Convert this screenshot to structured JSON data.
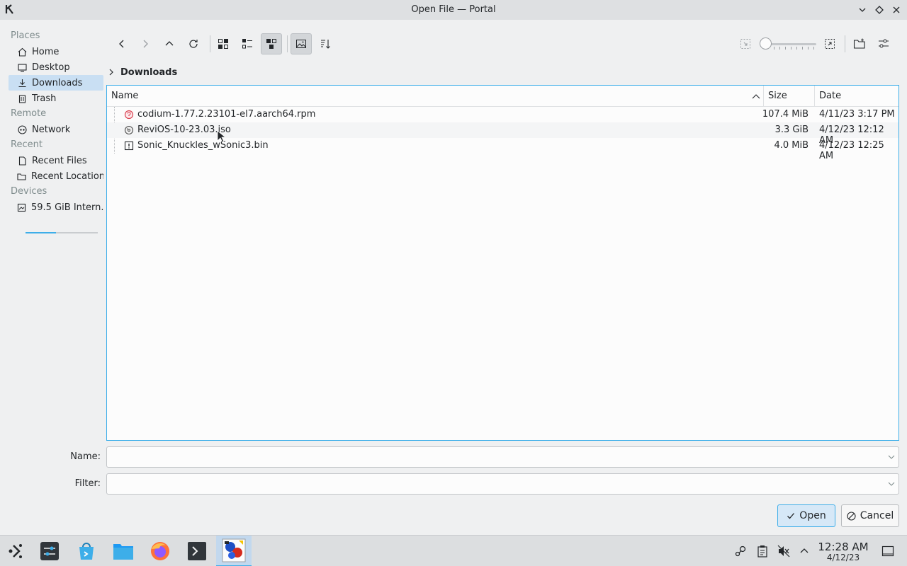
{
  "window": {
    "title": "Open File — Portal"
  },
  "sidebar": {
    "sections": [
      {
        "label": "Places",
        "items": [
          {
            "label": "Home",
            "icon": "home-icon"
          },
          {
            "label": "Desktop",
            "icon": "desktop-icon"
          },
          {
            "label": "Downloads",
            "icon": "download-icon",
            "active": true
          },
          {
            "label": "Trash",
            "icon": "trash-icon"
          }
        ]
      },
      {
        "label": "Remote",
        "items": [
          {
            "label": "Network",
            "icon": "network-icon"
          }
        ]
      },
      {
        "label": "Recent",
        "items": [
          {
            "label": "Recent Files",
            "icon": "recent-files-icon"
          },
          {
            "label": "Recent Locations",
            "icon": "recent-locations-icon"
          }
        ]
      },
      {
        "label": "Devices",
        "items": [
          {
            "label": "59.5 GiB Intern...",
            "icon": "drive-icon"
          }
        ]
      }
    ]
  },
  "breadcrumb": {
    "current": "Downloads"
  },
  "filelist": {
    "columns": {
      "name": "Name",
      "size": "Size",
      "date": "Date"
    },
    "rows": [
      {
        "name": "codium-1.77.2.23101-el7.aarch64.rpm",
        "size": "107.4 MiB",
        "date": "4/11/23 3:17 PM",
        "icon": "rpm-package-icon"
      },
      {
        "name": "ReviOS-10-23.03.iso",
        "size": "3.3 GiB",
        "date": "4/12/23 12:12 AM",
        "icon": "disc-image-icon"
      },
      {
        "name": "Sonic_Knuckles_wSonic3.bin",
        "size": "4.0 MiB",
        "date": "4/12/23 12:25 AM",
        "icon": "binary-file-icon"
      }
    ]
  },
  "form": {
    "name_label": "Name:",
    "filter_label": "Filter:",
    "name_value": "",
    "filter_value": ""
  },
  "buttons": {
    "open": "Open",
    "cancel": "Cancel"
  },
  "taskbar": {
    "clock_time": "12:28 AM",
    "clock_date": "4/12/23"
  },
  "colors": {
    "accent": "#3daee9",
    "selection": "#c9dff3"
  }
}
